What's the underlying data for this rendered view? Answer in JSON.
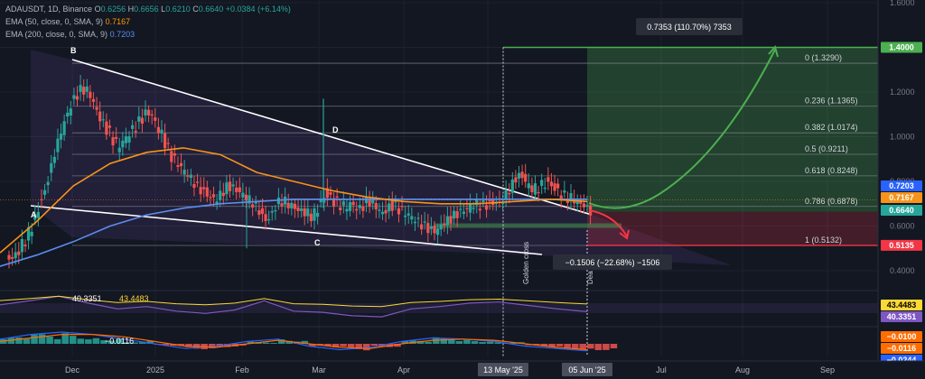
{
  "header": {
    "symbol": "ADAUSDT, 1D, Binance",
    "open_label": "O",
    "open": "0.6256",
    "high_label": "H",
    "high": "0.6656",
    "low_label": "L",
    "low": "0.6210",
    "close_label": "C",
    "close": "0.6640",
    "change": "+0.0384 (+6.14%)",
    "ema50_label": "EMA (50, close, 0, SMA, 9)",
    "ema50": "0.7167",
    "ema200_label": "EMA (200, close, 0, SMA, 9)",
    "ema200": "0.7203"
  },
  "colors": {
    "background": "#131722",
    "up": "#26a69a",
    "down": "#ef5350",
    "ema50": "#f7931a",
    "ema200": "#5b8def",
    "target": "#4caf50",
    "stop": "#f23645",
    "rsi": "#7e57c2",
    "rsi_ma": "#fdd835",
    "macd": "#2962ff",
    "macd_signal": "#ff6d00"
  },
  "chart_data": {
    "type": "candlestick",
    "ylim": [
      0.38,
      1.6
    ],
    "x_ticks": [
      "Dec",
      "2025",
      "Feb",
      "Mar",
      "Apr",
      "May",
      "Jul",
      "Aug",
      "Sep"
    ],
    "y_ticks": [
      "1.6000",
      "1.4000",
      "1.2000",
      "1.0000",
      "0.8000",
      "0.6000",
      "0.4000"
    ],
    "date_badges": [
      "13 May '25",
      "05 Jun '25"
    ],
    "price_badges": [
      {
        "text": "1.4000",
        "value": 1.4,
        "color": "#4caf50"
      },
      {
        "text": "0.7203",
        "value": 0.7203,
        "color": "#2962ff"
      },
      {
        "text": "0.7167",
        "value": 0.7167,
        "color": "#f7931a"
      },
      {
        "text": "0.6640",
        "value": 0.664,
        "color": "#26a69a"
      },
      {
        "text": "0.5135",
        "value": 0.5135,
        "color": "#f23645"
      }
    ],
    "fib_levels": [
      {
        "label": "0 (1.3290)",
        "value": 1.329
      },
      {
        "label": "0.236 (1.1365)",
        "value": 1.1365
      },
      {
        "label": "0.382 (1.0174)",
        "value": 1.0174
      },
      {
        "label": "0.5 (0.9211)",
        "value": 0.9211
      },
      {
        "label": "0.618 (0.8248)",
        "value": 0.8248
      },
      {
        "label": "0.786 (0.6878)",
        "value": 0.6878
      },
      {
        "label": "1 (0.5132)",
        "value": 0.5132
      }
    ],
    "pattern_points": [
      "A",
      "B",
      "C",
      "D"
    ],
    "annotations": {
      "target_box": "0.7353 (110.70%) 7353",
      "stop_box": "−0.1506 (−22.68%) −1506",
      "golden_cross": "Golden cross",
      "death_cross": "Dea"
    },
    "price_path": [
      [
        0.45,
        0.5,
        0.55,
        0.62,
        0.7,
        0.78,
        0.9,
        1.0,
        1.08,
        1.15,
        1.2,
        1.22,
        1.18,
        1.1,
        1.05
      ],
      [
        1.0,
        0.95,
        0.98,
        1.02,
        1.05,
        1.1,
        1.12,
        1.05,
        1.0,
        0.92,
        0.88,
        0.85,
        0.82,
        0.78,
        0.76
      ],
      [
        0.74,
        0.72,
        0.75,
        0.78,
        0.76,
        0.74,
        0.72,
        0.7,
        0.66,
        0.62,
        0.68,
        0.72,
        0.7,
        0.68,
        0.66
      ],
      [
        0.66,
        0.64,
        0.7,
        0.75,
        0.72,
        0.7,
        0.68,
        0.7,
        0.66,
        0.7,
        0.72,
        0.68,
        0.66,
        0.7,
        0.68
      ],
      [
        0.66,
        0.64,
        0.62,
        0.6,
        0.59,
        0.58,
        0.62,
        0.63,
        0.65,
        0.66,
        0.68,
        0.7,
        0.69,
        0.7,
        0.71
      ],
      [
        0.72,
        0.75,
        0.8,
        0.83,
        0.78,
        0.76,
        0.78,
        0.8,
        0.78,
        0.75,
        0.73,
        0.72,
        0.7,
        0.68,
        0.66
      ]
    ],
    "ema50_path": [
      0.48,
      0.62,
      0.78,
      0.88,
      0.93,
      0.95,
      0.92,
      0.84,
      0.8,
      0.76,
      0.73,
      0.71,
      0.7,
      0.7,
      0.71,
      0.72,
      0.71
    ],
    "ema200_path": [
      0.42,
      0.47,
      0.53,
      0.6,
      0.65,
      0.68,
      0.7,
      0.71,
      0.72,
      0.72,
      0.72,
      0.72,
      0.72,
      0.72,
      0.72,
      0.72,
      0.72
    ],
    "rsi": {
      "values_label": "43.4483",
      "ma_label": "40.3351",
      "badges": [
        "43.4483",
        "40.3351"
      ],
      "series": [
        55,
        62,
        70,
        58,
        48,
        52,
        44,
        40,
        46,
        62,
        44,
        42,
        36,
        34,
        48,
        52,
        58,
        60,
        54,
        48,
        43
      ]
    },
    "macd": {
      "values_label": "−0.0116",
      "badges": [
        "−0.0100",
        "−0.0116",
        "−0.0244"
      ],
      "hist": [
        0.6,
        0.9,
        1.0,
        0.7,
        0.3,
        -0.2,
        -0.5,
        -0.3,
        0.2,
        0.5,
        -0.4,
        -0.6,
        -0.3,
        0.3,
        0.6,
        0.4,
        0.2,
        -0.3,
        -0.5,
        -0.6
      ],
      "line": [
        0.4,
        0.8,
        1.0,
        0.8,
        0.4,
        0.0,
        -0.4,
        -0.2,
        0.2,
        0.4,
        -0.2,
        -0.5,
        -0.3,
        0.2,
        0.5,
        0.4,
        0.2,
        -0.2,
        -0.4,
        -0.6
      ],
      "signal": [
        0.2,
        0.5,
        0.8,
        0.8,
        0.6,
        0.2,
        -0.2,
        -0.3,
        0.0,
        0.3,
        0.0,
        -0.3,
        -0.4,
        0.0,
        0.3,
        0.4,
        0.3,
        0.0,
        -0.3,
        -0.5
      ]
    }
  }
}
